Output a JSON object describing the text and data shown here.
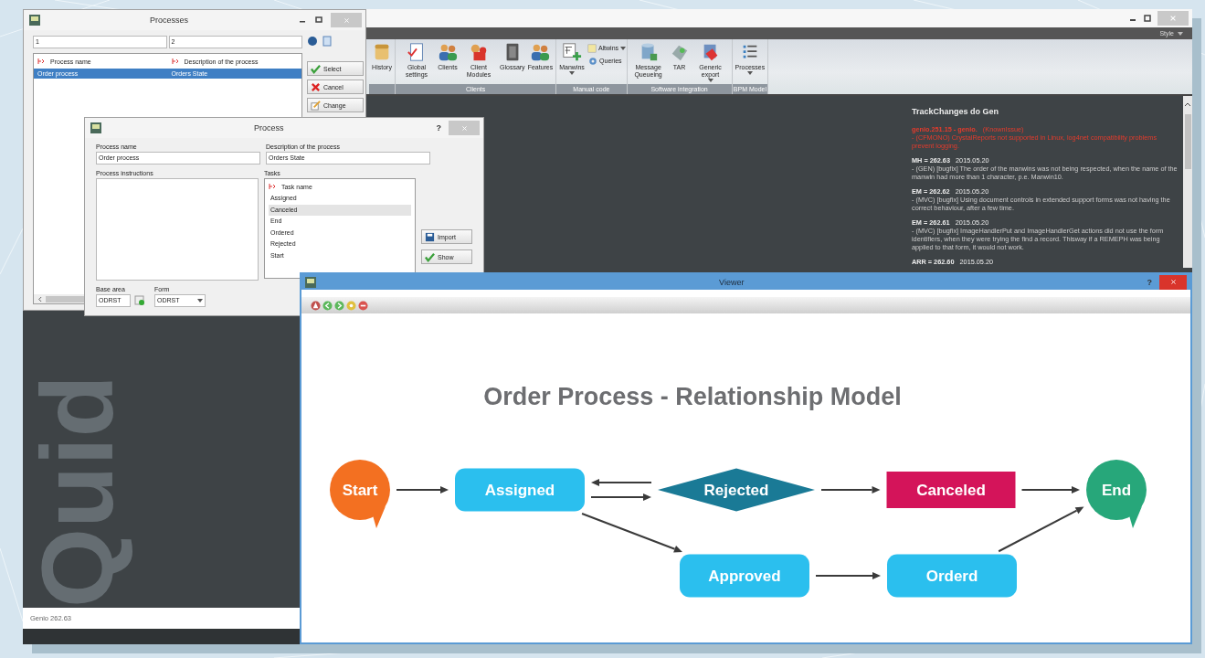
{
  "main_window": {
    "style_menu": "Style",
    "ribbon": {
      "groups": [
        {
          "items": [
            {
              "label": "History",
              "dropdown": false,
              "kind": "large"
            }
          ]
        },
        {
          "label": "Clients",
          "items": [
            {
              "label": "Global settings",
              "dropdown": false,
              "kind": "large"
            },
            {
              "label": "Clients",
              "dropdown": false,
              "kind": "large"
            },
            {
              "label": "Client Modules",
              "dropdown": false,
              "kind": "large"
            },
            {
              "label": "Glossary",
              "dropdown": false,
              "kind": "large"
            },
            {
              "label": "Features",
              "dropdown": false,
              "kind": "large"
            }
          ]
        },
        {
          "label": "Manual code",
          "items": [
            {
              "label": "Manwins",
              "dropdown": true,
              "kind": "large"
            },
            {
              "label": "Altwins",
              "dropdown": true,
              "kind": "small"
            },
            {
              "label": "Queries",
              "dropdown": false,
              "kind": "small"
            }
          ]
        },
        {
          "label": "Software integration",
          "items": [
            {
              "label": "Message Queueing",
              "dropdown": false,
              "kind": "large"
            },
            {
              "label": "TAR",
              "dropdown": false,
              "kind": "large"
            },
            {
              "label": "Generic export",
              "dropdown": true,
              "kind": "large"
            }
          ]
        },
        {
          "label": "BPM Model",
          "items": [
            {
              "label": "Processes",
              "dropdown": true,
              "kind": "large"
            }
          ]
        }
      ]
    },
    "track_changes": {
      "title": "TrackChanges do Gen",
      "entries": [
        {
          "kind": "issue",
          "heading": "genio.251.15 - genio.",
          "tag": "(KnownIssue)",
          "text": "- (CFMONO) CrystalReports not supported in Linux, log4net compatibility problems prevent logging."
        },
        {
          "kind": "change",
          "heading": "MH = 262.63",
          "date": "2015.05.20",
          "text": "- (GEN) [bugfix] The order of the manwins was not being respected, when the name of the manwin had more than 1 character, p.e. Manwin10."
        },
        {
          "kind": "change",
          "heading": "EM = 262.62",
          "date": "2015.05.20",
          "text": "- (MVC) [bugfix] Using document controls in extended support forms was not having the correct behaviour, after a few time."
        },
        {
          "kind": "change",
          "heading": "EM = 262.61",
          "date": "2015.05.20",
          "text": "- (MVC) [bugfix] ImageHandlerPut and ImageHandlerGet actions did not use the form identifiers, when they were trying the find a record. Thisway if a REMEPH was being applied to that form, it would not work."
        },
        {
          "kind": "change",
          "heading": "ARR = 262.60",
          "date": "2015.05.20"
        }
      ]
    },
    "watermark": "Quid",
    "status_bar": "Genio 262.63"
  },
  "processes_window": {
    "title": "Processes",
    "filters": [
      "1",
      "2"
    ],
    "columns": [
      "Process name",
      "Description of the process"
    ],
    "rows": [
      {
        "cells": [
          "Order process",
          "Orders State"
        ],
        "selected": true
      }
    ],
    "buttons": [
      "Select",
      "Cancel",
      "Change"
    ]
  },
  "process_window": {
    "title": "Process",
    "help": "?",
    "name_field": {
      "label": "Process name",
      "value": "Order process"
    },
    "description_field": {
      "label": "Description of the process",
      "value": "Orders State"
    },
    "instructions": {
      "label": "Process instructions"
    },
    "tasks": {
      "label": "Tasks",
      "column": "Task name",
      "items": [
        {
          "name": "Assigned",
          "selected": false
        },
        {
          "name": "Canceled",
          "selected": true
        },
        {
          "name": "End",
          "selected": false
        },
        {
          "name": "Ordered",
          "selected": false
        },
        {
          "name": "Rejected",
          "selected": false
        },
        {
          "name": "Start",
          "selected": false
        }
      ]
    },
    "buttons": [
      "Import",
      "Show"
    ],
    "base_area": {
      "label": "Base area",
      "value": "ODRST"
    },
    "form": {
      "label": "Form",
      "value": "ODRST"
    }
  },
  "viewer_window": {
    "title": "Viewer",
    "help": "?",
    "diagram": {
      "title": "Order Process - Relationship Model",
      "nodes": [
        {
          "label": "Start",
          "kind": "circle",
          "color": "#f37021"
        },
        {
          "label": "Assigned",
          "kind": "rounded",
          "color": "#2bbfee"
        },
        {
          "label": "Rejected",
          "kind": "diamond",
          "color": "#1a7a96"
        },
        {
          "label": "Canceled",
          "kind": "rect",
          "color": "#d4145a"
        },
        {
          "label": "End",
          "kind": "circle",
          "color": "#27a77a"
        },
        {
          "label": "Approved",
          "kind": "rounded",
          "color": "#2bbfee"
        },
        {
          "label": "Orderd",
          "kind": "rounded",
          "color": "#2bbfee"
        }
      ]
    }
  }
}
